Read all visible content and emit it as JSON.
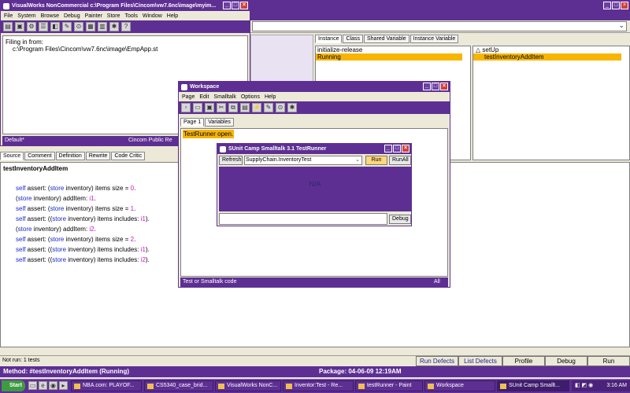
{
  "main_window": {
    "title": "VisualWorks NonCommercial  c:\\Program Files\\Cincom\\vw7.6nc\\image\\myim...",
    "menu": [
      "File",
      "System",
      "Browse",
      "Debug",
      "Painter",
      "Store",
      "Tools",
      "Window",
      "Help"
    ],
    "transcript": [
      "Filing in from:",
      "    c:\\Program Files\\Cincom\\vw7.6nc\\image\\EmpApp.st"
    ],
    "left_status": "Default*",
    "right_status": "Cincom Public Re"
  },
  "browser": {
    "tabs_top": [
      "Instance",
      "Class",
      "Shared Variable",
      "Instance Variable"
    ],
    "protocols": [
      "initialize-release",
      "Running"
    ],
    "methods": [
      "△  setUp",
      "testInventoryAddItem"
    ],
    "source_tabs": [
      "Source",
      "Comment",
      "Definition",
      "Rewrite",
      "Code Critic"
    ],
    "method_name": "testInventoryAddItem",
    "code": [
      [
        [
          "kw",
          "self"
        ],
        [
          "t",
          " assert: ("
        ],
        [
          "kw",
          "store"
        ],
        [
          "t",
          " inventory) items size = "
        ],
        [
          "num",
          "0"
        ],
        [
          "t",
          "."
        ]
      ],
      [
        [
          "t",
          "("
        ],
        [
          "kw",
          "store"
        ],
        [
          "t",
          " inventory) addItem: "
        ],
        [
          "num",
          "i1"
        ],
        [
          "t",
          "."
        ]
      ],
      [
        [
          "kw",
          "self"
        ],
        [
          "t",
          " assert: ("
        ],
        [
          "kw",
          "store"
        ],
        [
          "t",
          " inventory) items size = "
        ],
        [
          "num",
          "1"
        ],
        [
          "t",
          "."
        ]
      ],
      [
        [
          "kw",
          "self"
        ],
        [
          "t",
          " assert: (("
        ],
        [
          "kw",
          "store"
        ],
        [
          "t",
          " inventory) items includes: "
        ],
        [
          "num",
          "i1"
        ],
        [
          "t",
          ")."
        ]
      ],
      [
        [
          "t",
          "("
        ],
        [
          "kw",
          "store"
        ],
        [
          "t",
          " inventory) addItem: "
        ],
        [
          "num",
          "i2"
        ],
        [
          "t",
          "."
        ]
      ],
      [
        [
          "kw",
          "self"
        ],
        [
          "t",
          " assert: ("
        ],
        [
          "kw",
          "store"
        ],
        [
          "t",
          " inventory) items size = "
        ],
        [
          "num",
          "2"
        ],
        [
          "t",
          "."
        ]
      ],
      [
        [
          "kw",
          "self"
        ],
        [
          "t",
          " assert: (("
        ],
        [
          "kw",
          "store"
        ],
        [
          "t",
          " inventory) items includes: "
        ],
        [
          "num",
          "i1"
        ],
        [
          "t",
          ")."
        ]
      ],
      [
        [
          "kw",
          "self"
        ],
        [
          "t",
          " assert: (("
        ],
        [
          "kw",
          "store"
        ],
        [
          "t",
          " inventory) items includes: "
        ],
        [
          "num",
          "i2"
        ],
        [
          "t",
          ")."
        ]
      ]
    ],
    "not_run": "Not run: 1 tests",
    "bottom_buttons": [
      "Run Defects",
      "List Defects",
      "Profile",
      "Debug",
      "Run"
    ],
    "method_status": "Method: #testInventoryAddItem (Running)",
    "package_status": "Package: 04-06-09 12:19AM"
  },
  "workspace": {
    "title": "Workspace",
    "menu": [
      "Page",
      "Edit",
      "Smalltalk",
      "Options",
      "Help"
    ],
    "tabs": [
      "Page 1",
      "Variables"
    ],
    "text": "TestRunner open.",
    "status": "Test or Smalltalk code",
    "status_right": "All"
  },
  "testrunner": {
    "title": "SUnit Camp Smalltalk 3.1 TestRunner",
    "refresh": "Refresh",
    "selected_test": "SupplyChain.InventoryTest",
    "run": "Run",
    "runall": "RunAll",
    "result": "N/A",
    "debug": "Debug"
  },
  "taskbar": {
    "start": "Start",
    "tasks": [
      "NBA.com: PLAYOF...",
      "CS5340_case_brid...",
      "VisualWorks NonC...",
      "Inventor:Test - Re...",
      "testRunner - Paint",
      "Workspace",
      "SUnit Camp Smallt..."
    ],
    "clock": "3:16 AM"
  }
}
